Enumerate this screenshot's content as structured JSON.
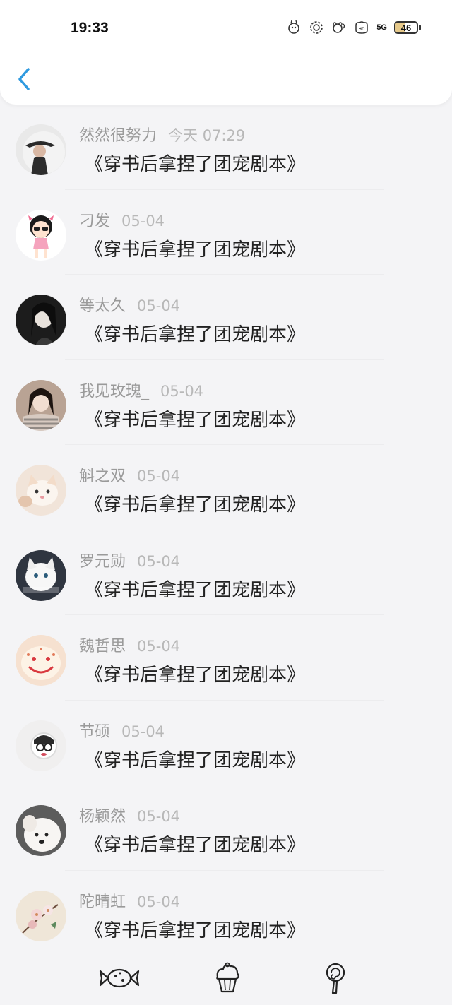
{
  "status_bar": {
    "time": "19:33",
    "network": "5G",
    "battery_level": "46",
    "battery_fraction": 0.46,
    "icons": [
      "rabbit-icon",
      "gear-flower-icon",
      "bear-wifi-icon",
      "hd-icon"
    ]
  },
  "header": {
    "back_icon": "chevron-left-icon",
    "accent_color": "#2f9ae0"
  },
  "comments": [
    {
      "name": "然然很努力",
      "date": "今天 07:29",
      "text": "《穿书后拿捏了团宠剧本》",
      "avatar": "avatar-girl-hat"
    },
    {
      "name": "刁发",
      "date": "05-04",
      "text": "《穿书后拿捏了团宠剧本》",
      "avatar": "avatar-cartoon-girl"
    },
    {
      "name": "等太久",
      "date": "05-04",
      "text": "《穿书后拿捏了团宠剧本》",
      "avatar": "avatar-girl-dark"
    },
    {
      "name": "我见玫瑰_",
      "date": "05-04",
      "text": "《穿书后拿捏了团宠剧本》",
      "avatar": "avatar-girl-stripes"
    },
    {
      "name": "斛之双",
      "date": "05-04",
      "text": "《穿书后拿捏了团宠剧本》",
      "avatar": "avatar-kitten"
    },
    {
      "name": "罗元勋",
      "date": "05-04",
      "text": "《穿书后拿捏了团宠剧本》",
      "avatar": "avatar-white-cat"
    },
    {
      "name": "魏哲思",
      "date": "05-04",
      "text": "《穿书后拿捏了团宠剧本》",
      "avatar": "avatar-smiley-cake"
    },
    {
      "name": "节硕",
      "date": "05-04",
      "text": "《穿书后拿捏了团宠剧本》",
      "avatar": "avatar-glasses-figure"
    },
    {
      "name": "杨颖然",
      "date": "05-04",
      "text": "《穿书后拿捏了团宠剧本》",
      "avatar": "avatar-white-dog"
    },
    {
      "name": "陀晴虹",
      "date": "05-04",
      "text": "《穿书后拿捏了团宠剧本》",
      "avatar": "avatar-flower-painting"
    }
  ],
  "tabbar": {
    "tabs": [
      {
        "icon": "candy-icon"
      },
      {
        "icon": "cupcake-icon"
      },
      {
        "icon": "lollipop-icon"
      }
    ]
  }
}
